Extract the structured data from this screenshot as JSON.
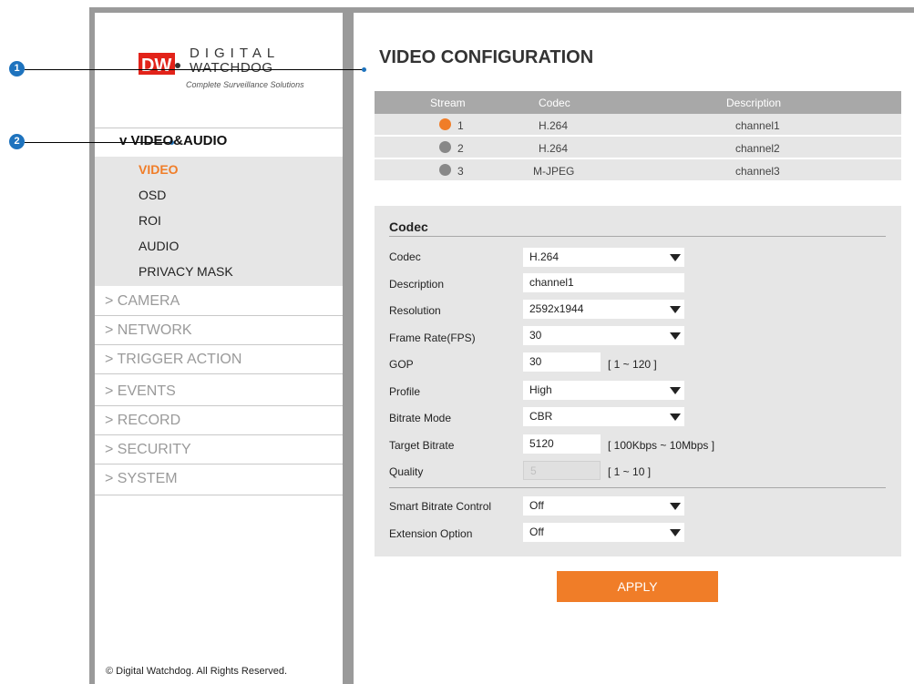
{
  "brand": {
    "logo_mark": "DW",
    "name_line1": "DIGITAL",
    "name_line2": "WATCHDOG",
    "tagline": "Complete Surveillance Solutions",
    "colors": {
      "logo_red": "#e2231a",
      "accent": "#f07d28",
      "callout": "#1e73be"
    }
  },
  "callouts": [
    "1",
    "2"
  ],
  "sidebar": {
    "expanded_section": "v VIDEO&AUDIO",
    "sub_items": [
      "VIDEO",
      "OSD",
      "ROI",
      "AUDIO",
      "PRIVACY MASK"
    ],
    "active_sub_item": "VIDEO",
    "sections": [
      "> CAMERA",
      "> NETWORK",
      "> TRIGGER ACTION",
      "> EVENTS",
      "> RECORD",
      "> SECURITY",
      "> SYSTEM"
    ],
    "copyright": "© Digital Watchdog. All Rights Reserved."
  },
  "main": {
    "title": "VIDEO CONFIGURATION",
    "stream_table": {
      "headers": [
        "Stream",
        "Codec",
        "Description"
      ],
      "rows": [
        {
          "stream": "1",
          "codec": "H.264",
          "description": "channel1",
          "selected": true
        },
        {
          "stream": "2",
          "codec": "H.264",
          "description": "channel2",
          "selected": false
        },
        {
          "stream": "3",
          "codec": "M-JPEG",
          "description": "channel3",
          "selected": false
        }
      ]
    },
    "codec_panel": {
      "title": "Codec",
      "fields": {
        "codec": {
          "label": "Codec",
          "value": "H.264"
        },
        "description": {
          "label": "Description",
          "value": "channel1"
        },
        "resolution": {
          "label": "Resolution",
          "value": "2592x1944"
        },
        "frame_rate": {
          "label": "Frame Rate(FPS)",
          "value": "30"
        },
        "gop": {
          "label": "GOP",
          "value": "30",
          "range": "[ 1 ~ 120 ]"
        },
        "profile": {
          "label": "Profile",
          "value": "High"
        },
        "bitrate_mode": {
          "label": "Bitrate Mode",
          "value": "CBR"
        },
        "target_bitrate": {
          "label": "Target Bitrate",
          "value": "5120",
          "range": "[ 100Kbps ~ 10Mbps ]"
        },
        "quality": {
          "label": "Quality",
          "value": "5",
          "range": "[ 1 ~ 10 ]"
        },
        "smart_bitrate": {
          "label": "Smart Bitrate Control",
          "value": "Off"
        },
        "extension_option": {
          "label": "Extension Option",
          "value": "Off"
        }
      }
    },
    "apply_label": "APPLY"
  }
}
